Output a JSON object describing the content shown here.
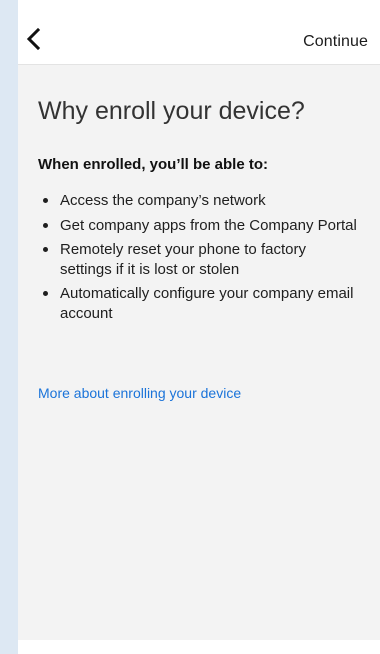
{
  "nav": {
    "back_icon": "chevron-left-icon",
    "continue_label": "Continue"
  },
  "main": {
    "title": "Why enroll your device?",
    "subheading": "When enrolled, you’ll be able to:",
    "benefits": [
      "Access the company’s network",
      "Get company apps from the Company Portal",
      "Remotely reset your phone to factory settings if it is lost or stolen",
      "Automatically configure your company email account"
    ],
    "more_link": "More about enrolling your device"
  },
  "colors": {
    "link": "#1a73d9",
    "content_background": "#f3f3f3",
    "left_strip": "#dde8f3"
  }
}
